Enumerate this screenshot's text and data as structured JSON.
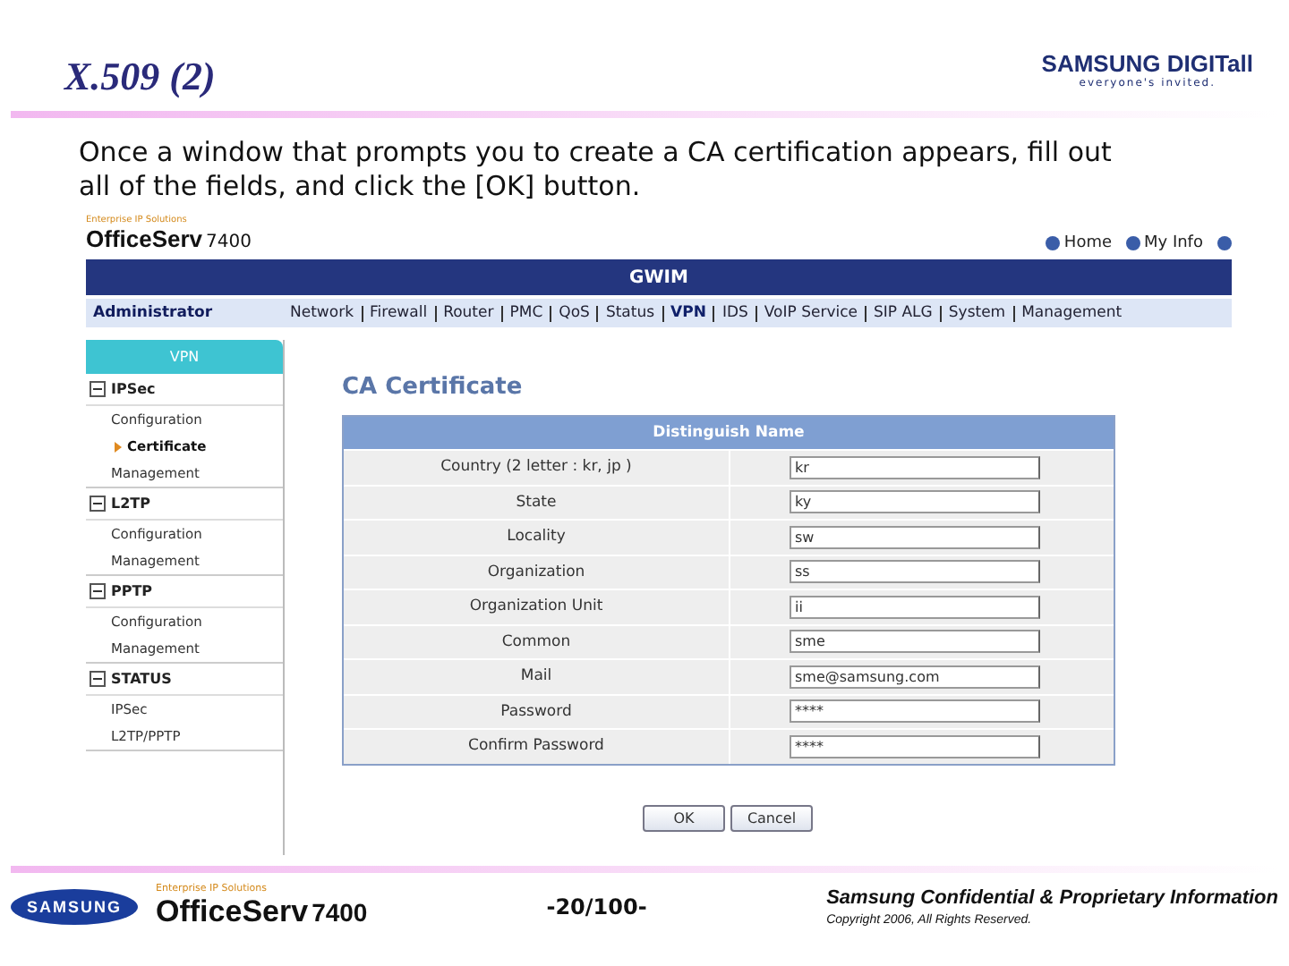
{
  "slide": {
    "title": "X.509 (2)",
    "brand": "SAMSUNG DIGITall",
    "brand_tagline": "everyone's invited.",
    "body": "Once a window that prompts you to create a CA certification appears, fill out all of the fields, and click the [OK] button."
  },
  "app": {
    "tagline": "Enterprise IP Solutions",
    "product": "OfficeServ",
    "model": "7400",
    "top_links": [
      "Home",
      "My Info"
    ],
    "banner": "GWIM",
    "user": "Administrator",
    "menu": [
      {
        "label": "Network",
        "selected": false
      },
      {
        "label": "Firewall",
        "selected": false
      },
      {
        "label": "Router",
        "selected": false
      },
      {
        "label": "PMC",
        "selected": false
      },
      {
        "label": "QoS",
        "selected": false
      },
      {
        "label": "Status",
        "selected": false
      },
      {
        "label": "VPN",
        "selected": true
      },
      {
        "label": "IDS",
        "selected": false
      },
      {
        "label": "VoIP Service",
        "selected": false
      },
      {
        "label": "SIP ALG",
        "selected": false
      },
      {
        "label": "System",
        "selected": false
      },
      {
        "label": "Management",
        "selected": false
      }
    ],
    "sidebar": {
      "title": "VPN",
      "sections": [
        {
          "label": "IPSec",
          "expanded": true,
          "children": [
            {
              "label": "Configuration",
              "selected": false
            },
            {
              "label": "Certificate",
              "selected": true
            },
            {
              "label": "Management",
              "selected": false
            }
          ]
        },
        {
          "label": "L2TP",
          "expanded": true,
          "children": [
            {
              "label": "Configuration",
              "selected": false
            },
            {
              "label": "Management",
              "selected": false
            }
          ]
        },
        {
          "label": "PPTP",
          "expanded": true,
          "children": [
            {
              "label": "Configuration",
              "selected": false
            },
            {
              "label": "Management",
              "selected": false
            }
          ]
        },
        {
          "label": "STATUS",
          "expanded": true,
          "children": [
            {
              "label": "IPSec",
              "selected": false
            },
            {
              "label": "L2TP/PPTP",
              "selected": false
            }
          ]
        }
      ]
    },
    "page_title": "CA Certificate",
    "table_header": "Distinguish Name",
    "fields": [
      {
        "label": "Country (2 letter : kr, jp )",
        "value": "kr"
      },
      {
        "label": "State",
        "value": "ky"
      },
      {
        "label": "Locality",
        "value": "sw"
      },
      {
        "label": "Organization",
        "value": "ss"
      },
      {
        "label": "Organization Unit",
        "value": "ii"
      },
      {
        "label": "Common",
        "value": "sme"
      },
      {
        "label": "Mail",
        "value": "sme@samsung.com"
      },
      {
        "label": "Password",
        "value": "****"
      },
      {
        "label": "Confirm Password",
        "value": "****"
      }
    ],
    "buttons": [
      "OK",
      "Cancel"
    ]
  },
  "footer": {
    "logo": "SAMSUNG",
    "tagline": "Enterprise IP Solutions",
    "product": "OfficeServ",
    "model": "7400",
    "page": "-20/100-",
    "confidential": "Samsung Confidential & Proprietary Information",
    "copyright": "Copyright 2006, All Rights Reserved."
  }
}
